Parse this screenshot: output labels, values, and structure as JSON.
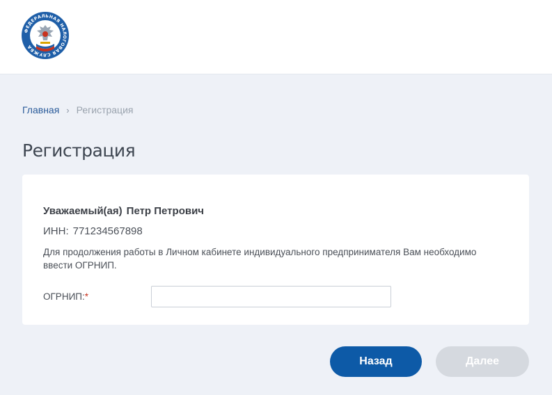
{
  "header": {
    "logo_icon": "fns-emblem-icon",
    "logo_text": "ФЕДЕРАЛЬНАЯ НАЛОГОВАЯ СЛУЖБА"
  },
  "breadcrumb": {
    "home": "Главная",
    "separator": "›",
    "current": "Регистрация"
  },
  "page": {
    "title": "Регистрация"
  },
  "card": {
    "greeting_prefix": "Уважаемый(ая)",
    "user_name": "Петр Петрович",
    "inn_label": "ИНН:",
    "inn_value": "771234567898",
    "notice": "Для продолжения работы в Личном кабинете индивидуального предпринимателя Вам необходимо ввести ОГРНИП.",
    "ogrnip_label": "ОГРНИП:",
    "required_mark": "*",
    "ogrnip_value": ""
  },
  "actions": {
    "back_label": "Назад",
    "next_label": "Далее"
  },
  "colors": {
    "primary": "#0d5aa7",
    "disabled": "#d5d9df",
    "required": "#c8321e",
    "link": "#2a5b9a"
  }
}
